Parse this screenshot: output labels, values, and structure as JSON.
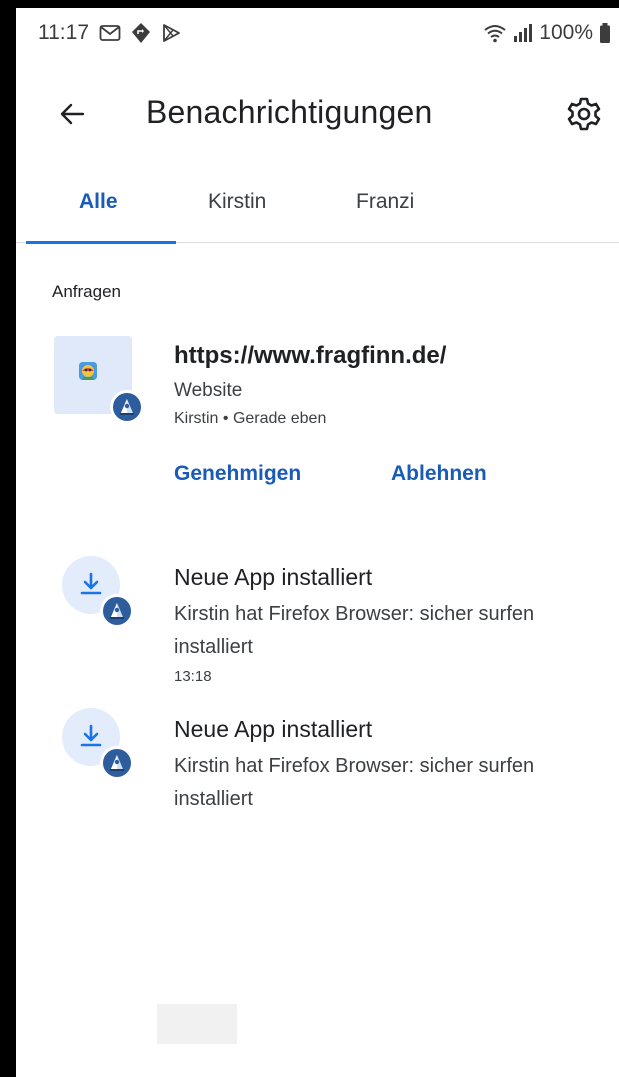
{
  "status_bar": {
    "time": "11:17",
    "battery": "100%"
  },
  "header": {
    "title": "Benachrichtigungen"
  },
  "tabs": [
    {
      "label": "Alle",
      "active": true
    },
    {
      "label": "Kirstin",
      "active": false
    },
    {
      "label": "Franzi",
      "active": false
    }
  ],
  "section": {
    "label": "Anfragen"
  },
  "request": {
    "title": "https://www.fragfinn.de/",
    "type": "Website",
    "meta": "Kirstin • Gerade eben",
    "approve_label": "Genehmigen",
    "deny_label": "Ablehnen"
  },
  "notifications": [
    {
      "title": "Neue App installiert",
      "body": "Kirstin hat Firefox Browser: sicher surfen installiert",
      "time": "13:18"
    },
    {
      "title": "Neue App installiert",
      "body": "Kirstin hat Firefox Browser: sicher surfen installiert"
    }
  ],
  "colors": {
    "accent": "#1a73e8",
    "badge": "#2d5d9c",
    "icon_bg": "#e3ecfb",
    "thumb_bg": "#dfe9fa"
  },
  "icons": [
    "gmail-icon",
    "maps-icon",
    "play-store-icon",
    "wifi-icon",
    "signal-icon",
    "battery-icon",
    "back-arrow-icon",
    "settings-gear-icon",
    "download-icon",
    "child-avatar-icon"
  ]
}
